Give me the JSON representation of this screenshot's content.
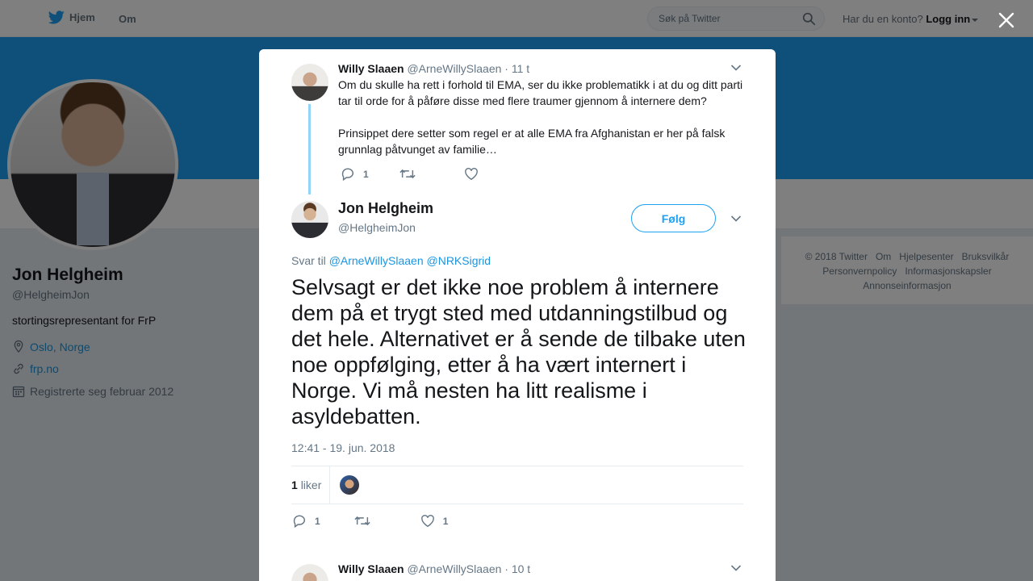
{
  "nav": {
    "home_label": "Hjem",
    "about_label": "Om",
    "search_placeholder": "Søk på Twitter",
    "account_prompt": "Har du en konto?",
    "login_label": "Logg inn"
  },
  "colors": {
    "brand_blue": "#1da1f2",
    "link_blue": "#1b95e0",
    "thread_line": "#90d4f7"
  },
  "profile": {
    "name": "Jon Helgheim",
    "handle": "@HelgheimJon",
    "bio": "stortingsrepresentant for FrP",
    "location": "Oslo, Norge",
    "website": "frp.no",
    "joined": "Registrerte seg februar 2012"
  },
  "footer": {
    "links": [
      "© 2018 Twitter",
      "Om",
      "Hjelpesenter",
      "Bruksvilkår",
      "Personvernpolicy",
      "Informasjonskapsler",
      "Annonseinformasjon"
    ]
  },
  "parent_tweet": {
    "name": "Willy Slaaen",
    "handle": "@ArneWillySlaaen",
    "time": "· 11 t",
    "text1": "Om du skulle ha rett i forhold til EMA, ser du ikke problematikk i at du og ditt parti tar til orde for å påføre disse med flere traumer gjennom å internere dem?",
    "text2": "Prinsippet dere setter som regel er at alle EMA fra Afghanistan er her på falsk grunnlag påtvunget av familie…",
    "reply_count": "1"
  },
  "main_tweet": {
    "name": "Jon Helgheim",
    "handle": "@HelgheimJon",
    "follow_label": "Følg",
    "reply_prefix": "Svar til",
    "mention1": "@ArneWillySlaaen",
    "mention2": "@NRKSigrid",
    "text": "Selvsagt er det ikke noe problem å internere dem på et trygt sted med utdanningstilbud og det hele. Alternativet er å sende de tilbake uten noe oppfølging, etter å ha vært internert i Norge. Vi må nesten ha litt realisme i asyldebatten.",
    "timestamp": "12:41 - 19. jun. 2018",
    "likes_count": "1",
    "likes_label": "liker",
    "reply_count": "1",
    "like_count": "1"
  },
  "next_tweet": {
    "name": "Willy Slaaen",
    "handle": "@ArneWillySlaaen",
    "time": "· 10 t"
  }
}
